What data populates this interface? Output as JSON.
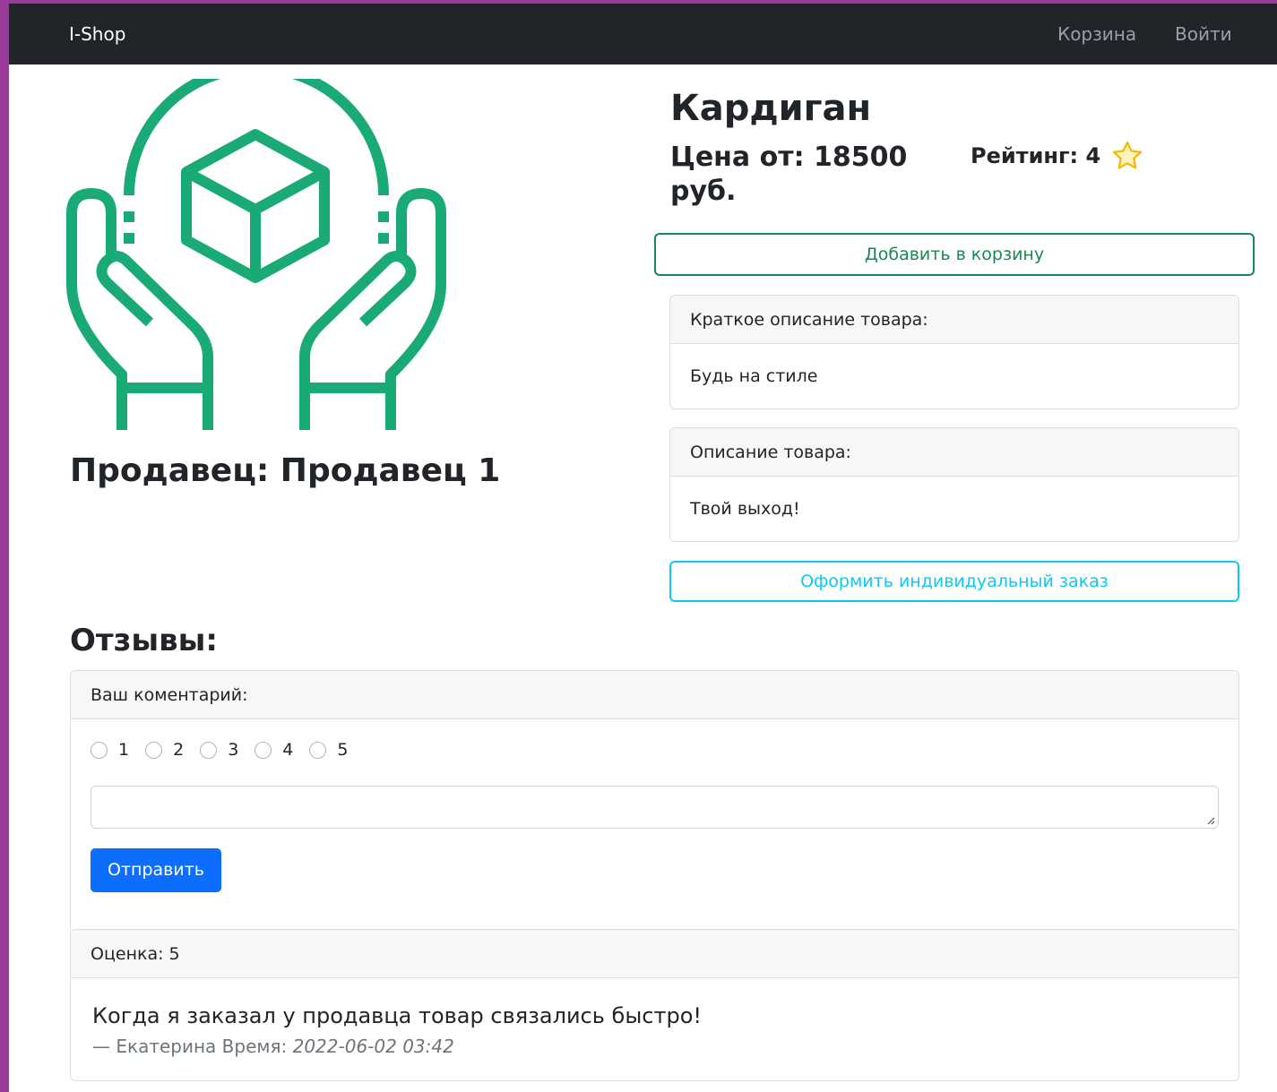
{
  "navbar": {
    "brand": "I-Shop",
    "cart_link": "Корзина",
    "login_link": "Войти"
  },
  "product": {
    "title": "Кардиган",
    "price": "Цена от: 18500 руб.",
    "rating": "Рейтинг: 4",
    "rating_icon": "star-icon",
    "seller": "Продавец: Продавец 1",
    "add_to_cart": "Добавить в корзину",
    "short_description_header": "Краткое описание товара:",
    "short_description": "Будь на стиле",
    "description_header": "Описание товара:",
    "description": "Твой выход!",
    "custom_order": "Оформить индивидуальный заказ",
    "image_icon": "hands-holding-box-icon"
  },
  "reviews": {
    "title": "Отзывы:",
    "form": {
      "header": "Ваш коментарий:",
      "options": [
        "1",
        "2",
        "3",
        "4",
        "5"
      ],
      "textarea_value": "",
      "submit": "Отправить"
    },
    "items": [
      {
        "score": "Оценка: 5",
        "text": "Когда я заказал у продавца товар связались быстро!",
        "author_prefix": "— Екатерина Время:",
        "time": "2022-06-02 03:42"
      }
    ]
  },
  "colors": {
    "navbar": "#212529",
    "accent_green": "#1aaa76",
    "success": "#198754",
    "info": "#0dcaf0",
    "primary": "#0d6efd",
    "frame": "#9a3a9a"
  }
}
